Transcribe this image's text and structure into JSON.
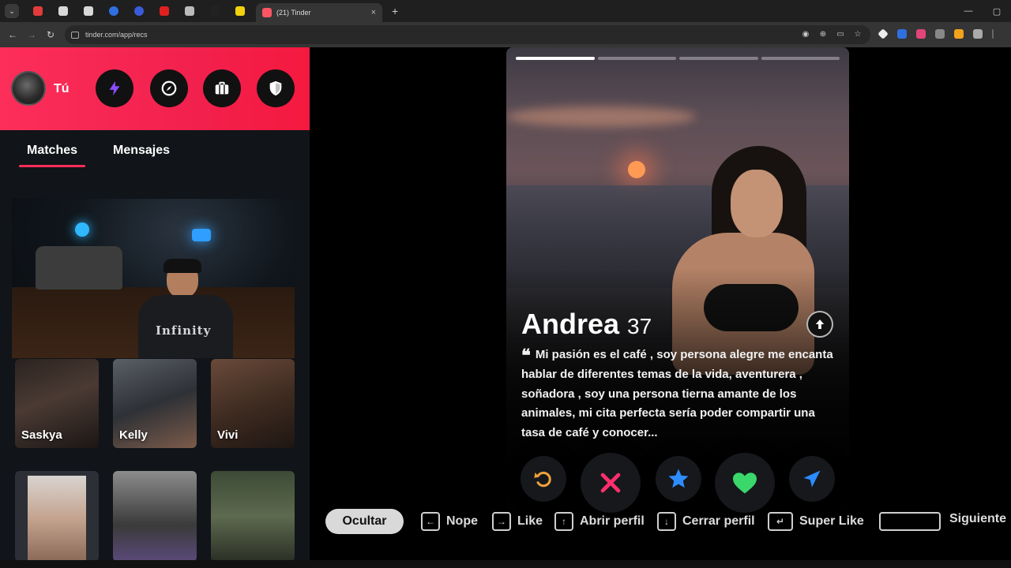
{
  "browser": {
    "active_tab_title": "(21) Tinder",
    "url": "tinder.com/app/recs",
    "pinned_tab_colors": [
      "#e33b3b",
      "#d8d8d8",
      "#d8d8d8",
      "#2f6fe0",
      "#3a5bd9",
      "#e02020",
      "#bbbbbb",
      "#222222",
      "#f2d20f"
    ]
  },
  "sidebar": {
    "user_label": "Tú",
    "tabs": [
      {
        "label": "Matches",
        "active": true
      },
      {
        "label": "Mensajes",
        "active": false
      }
    ],
    "webcam_shirt_text": "Infinity",
    "matches": [
      {
        "name": "Saskya"
      },
      {
        "name": "Kelly"
      },
      {
        "name": "Vivi"
      }
    ]
  },
  "profile": {
    "name": "Andrea",
    "age": "37",
    "photo_count": 4,
    "current_photo": 1,
    "bio": "Mi pasión es el café , soy persona alegre me encanta hablar de diferentes temas de la vida, aventurera , soñadora , soy una persona tierna amante de los animales, mi cita perfecta sería poder compartir una tasa de café y conocer...",
    "actions": [
      {
        "icon": "rewind-icon",
        "color": "#f0a13a"
      },
      {
        "icon": "nope-icon",
        "color": "#ff2f6e"
      },
      {
        "icon": "super-like-star-icon",
        "color": "#2f8cff"
      },
      {
        "icon": "like-heart-icon",
        "color": "#3ad76a"
      },
      {
        "icon": "boost-send-icon",
        "color": "#2a8cff"
      }
    ]
  },
  "shortcuts": {
    "hide_label": "Ocultar",
    "nope": "Nope",
    "like": "Like",
    "open_profile": "Abrir perfil",
    "close_profile": "Cerrar perfil",
    "super_like": "Super Like",
    "next": "Siguiente"
  },
  "colors": {
    "brand_gradient_start": "#fd2e5a",
    "brand_gradient_end": "#f5193f",
    "accent": "#fd2e5a"
  }
}
